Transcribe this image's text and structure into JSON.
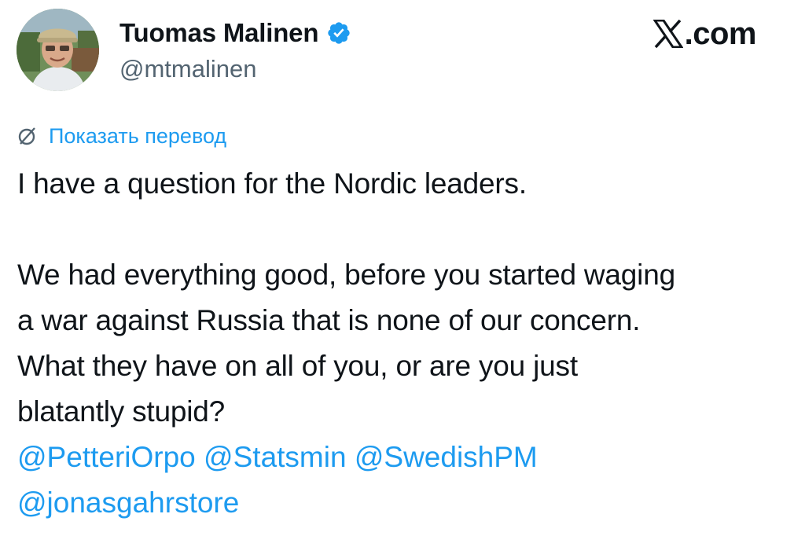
{
  "author": {
    "display_name": "Tuomas Malinen",
    "handle": "@mtmalinen",
    "verified_icon": "verified-badge-icon",
    "avatar_icon": "profile-avatar"
  },
  "source": {
    "label": ".com",
    "logo_icon": "x-logo-icon"
  },
  "translate": {
    "icon": "globe-icon",
    "label": "Показать перевод"
  },
  "tweet": {
    "lines": [
      "I have a question for the Nordic leaders.",
      "We had everything good, before you started waging",
      "a war against Russia that is none of our concern.",
      "What they have on all of you, or are you just",
      "blatantly stupid?"
    ],
    "mentions": [
      "@PetteriOrpo",
      "@Statsmin",
      "@SwedishPM",
      "@jonasgahrstore"
    ]
  },
  "colors": {
    "link": "#1d9bf0",
    "text": "#0f1419",
    "secondary": "#536471"
  }
}
